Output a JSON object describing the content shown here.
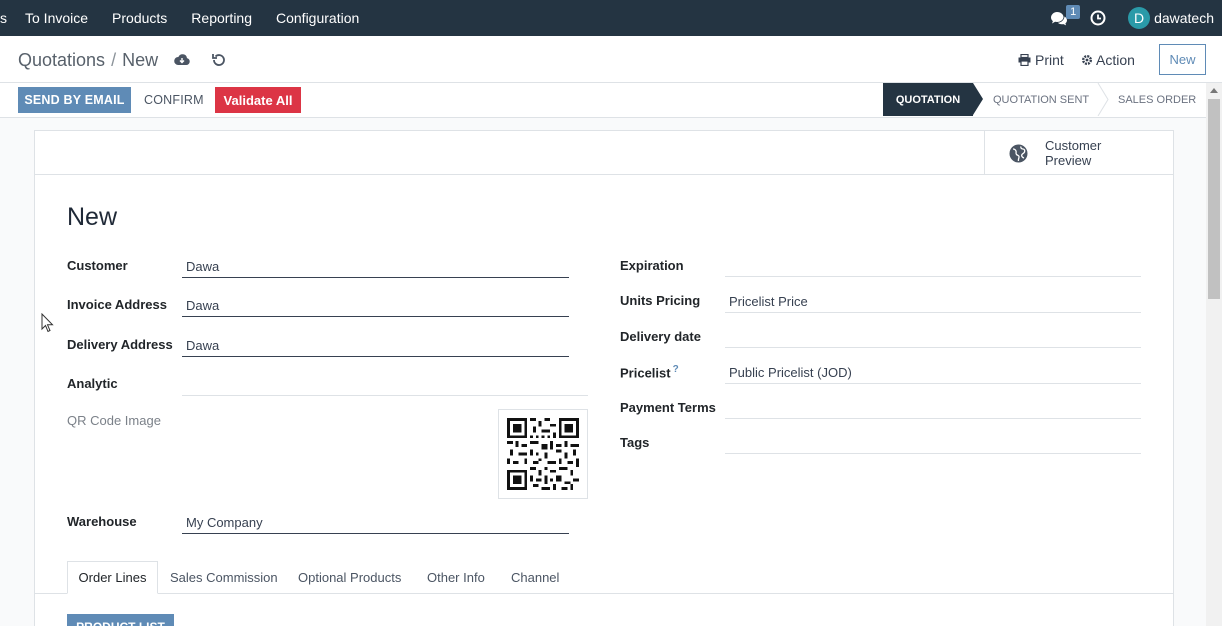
{
  "navbar": {
    "sliver": "s",
    "menu": [
      "To Invoice",
      "Products",
      "Reporting",
      "Configuration"
    ],
    "chat_count": "1",
    "avatar_letter": "D",
    "username": "dawatech"
  },
  "control": {
    "breadcrumb_parent": "Quotations",
    "breadcrumb_sep": "/",
    "breadcrumb_current": "New",
    "print_label": "Print",
    "action_label": "Action",
    "new_label": "New"
  },
  "statusbar": {
    "send_email": "SEND BY EMAIL",
    "confirm": "CONFIRM",
    "validate_all": "Validate All",
    "stages": [
      "QUOTATION",
      "QUOTATION SENT",
      "SALES ORDER"
    ],
    "active_stage": "QUOTATION"
  },
  "sheet": {
    "customer_preview": "Customer Preview",
    "title": "New",
    "left_fields": {
      "customer": {
        "label": "Customer",
        "value": "Dawa"
      },
      "invoice_address": {
        "label": "Invoice Address",
        "value": "Dawa"
      },
      "delivery_address": {
        "label": "Delivery Address",
        "value": "Dawa"
      },
      "analytic": {
        "label": "Analytic",
        "value": ""
      },
      "qr_code": {
        "label": "QR Code Image"
      },
      "warehouse": {
        "label": "Warehouse",
        "value": "My Company"
      }
    },
    "right_fields": {
      "expiration": {
        "label": "Expiration",
        "value": ""
      },
      "units_pricing": {
        "label": "Units Pricing",
        "value": "Pricelist Price"
      },
      "delivery_date": {
        "label": "Delivery date",
        "value": ""
      },
      "pricelist": {
        "label": "Pricelist",
        "help": "?",
        "value": "Public Pricelist (JOD)"
      },
      "payment_terms": {
        "label": "Payment Terms",
        "value": ""
      },
      "tags": {
        "label": "Tags",
        "value": ""
      }
    },
    "tabs": [
      "Order Lines",
      "Sales Commission",
      "Optional Products",
      "Other Info",
      "Channel"
    ],
    "active_tab": "Order Lines",
    "product_list_button": "PRODUCT LIST"
  },
  "colors": {
    "navbar": "#243442",
    "primary": "#5f8bb6",
    "danger": "#dc3545",
    "avatar": "#2a9aa8"
  }
}
